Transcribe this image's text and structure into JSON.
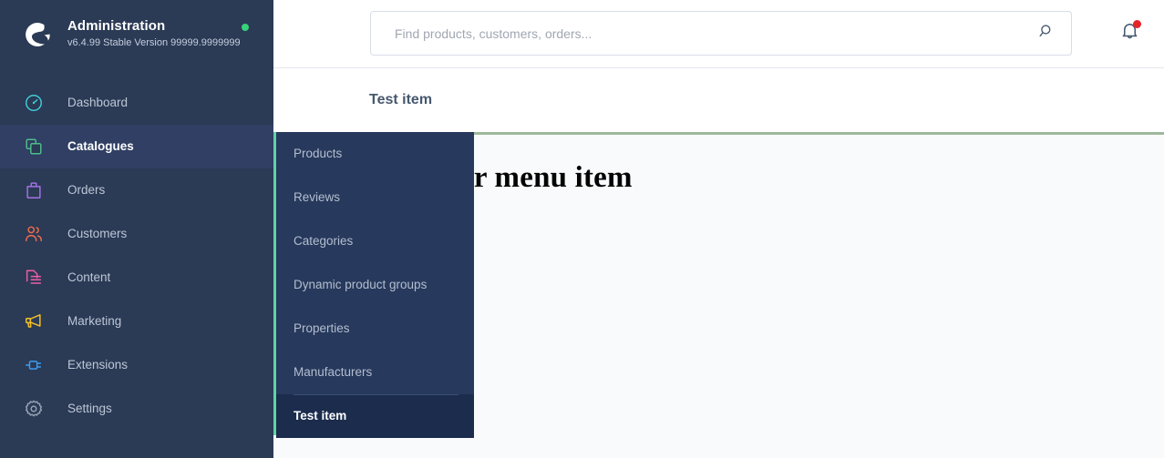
{
  "sidebar": {
    "brand": {
      "logo_icon": "shopware-logo-icon",
      "title": "Administration",
      "version": "v6.4.99 Stable Version 99999.9999999",
      "status_dot_color": "#37d279"
    },
    "items": [
      {
        "label": "Dashboard",
        "icon": "dashboard-gauge-icon",
        "color": "#3ecdd7",
        "active": false
      },
      {
        "label": "Catalogues",
        "icon": "catalogues-copy-icon",
        "color": "#4dbd8b",
        "active": true
      },
      {
        "label": "Orders",
        "icon": "orders-bag-icon",
        "color": "#a372e8",
        "active": false
      },
      {
        "label": "Customers",
        "icon": "customers-people-icon",
        "color": "#ef6c4d",
        "active": false
      },
      {
        "label": "Content",
        "icon": "content-page-icon",
        "color": "#ed5fa5",
        "active": false
      },
      {
        "label": "Marketing",
        "icon": "marketing-megaphone-icon",
        "color": "#f5c226",
        "active": false
      },
      {
        "label": "Extensions",
        "icon": "extensions-plug-icon",
        "color": "#3d9cf0",
        "active": false
      },
      {
        "label": "Settings",
        "icon": "settings-gear-icon",
        "color": "#97a2b2",
        "active": false
      }
    ]
  },
  "topbar": {
    "search": {
      "placeholder": "Find products, customers, orders...",
      "value": "",
      "icon": "search-icon"
    },
    "notifications": {
      "icon": "bell-icon",
      "has_unread": true,
      "dot_color": "#e52427"
    }
  },
  "subheader": {
    "title": "Test item"
  },
  "flyout": {
    "accent_color": "#5fd4a4",
    "items": [
      {
        "label": "Products",
        "active": false,
        "divider_above": false
      },
      {
        "label": "Reviews",
        "active": false,
        "divider_above": false
      },
      {
        "label": "Categories",
        "active": false,
        "divider_above": false
      },
      {
        "label": "Dynamic product groups",
        "active": false,
        "divider_above": false
      },
      {
        "label": "Properties",
        "active": false,
        "divider_above": false
      },
      {
        "label": "Manufacturers",
        "active": false,
        "divider_above": false
      },
      {
        "label": "Test item",
        "active": true,
        "divider_above": true
      }
    ]
  },
  "content": {
    "heading": "Hello from your menu item",
    "top_border_color": "#9db99d",
    "background": "#f9fafb"
  }
}
